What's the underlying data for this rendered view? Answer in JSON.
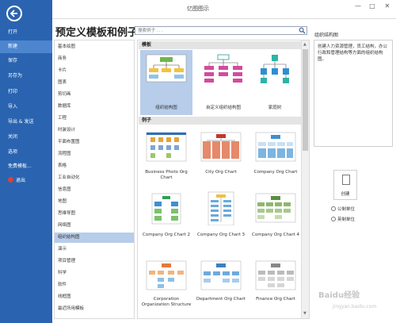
{
  "window": {
    "title": "亿图图示",
    "minimize": "—",
    "maximize": "□",
    "close": "✕"
  },
  "sidebar": {
    "back_icon": "arrow-left-icon",
    "items": [
      {
        "label": "打开"
      },
      {
        "label": "新建",
        "active": true
      },
      {
        "label": "保存"
      },
      {
        "label": "另存为"
      },
      {
        "label": "打印"
      },
      {
        "label": "导入"
      },
      {
        "label": "导出 & 发送"
      },
      {
        "label": "关闭"
      },
      {
        "label": "选项"
      },
      {
        "label": "免费模板..."
      },
      {
        "label": "退出"
      }
    ]
  },
  "main": {
    "heading": "预定义模板和例子",
    "search": {
      "placeholder": "搜索例子 . . .",
      "icon": "search-icon"
    }
  },
  "categories": [
    "基本绘图",
    "商务",
    "卡片",
    "图表",
    "剪切画",
    "数据库",
    "工程",
    "时装设计",
    "平面布置图",
    "流程图",
    "表格",
    "工业自动化",
    "信息图",
    "地图",
    "思维导图",
    "网络图",
    "组织结构图",
    "演示",
    "项目管理",
    "科学",
    "软件",
    "线框图",
    "最近所用模板"
  ],
  "selected_category": "组织结构图",
  "gallery": {
    "templates_header": "模板",
    "examples_header": "例子",
    "templates": [
      {
        "label": "组织结构图",
        "selected": true
      },
      {
        "label": "自定义组织结构图"
      },
      {
        "label": "家庭树"
      }
    ],
    "examples": [
      {
        "label": "Business Photo Org Chart"
      },
      {
        "label": "City Org Chart"
      },
      {
        "label": "Company Org Chart"
      },
      {
        "label": "Company Org Chart 2"
      },
      {
        "label": "Company Org Chart 3"
      },
      {
        "label": "Company Org Chart 4"
      },
      {
        "label": "Corporation Organization Structure"
      },
      {
        "label": "Department Org Chart"
      },
      {
        "label": "Finance Org Chart"
      }
    ]
  },
  "details": {
    "title": "组织结构图",
    "description": "创建人力资源管理，员工结构，办公行政和管理结构等方面的组织结构图。",
    "create_label": "创建",
    "units": [
      {
        "label": "公制单位",
        "checked": false
      },
      {
        "label": "英制单位",
        "checked": false
      }
    ]
  },
  "watermark": {
    "text": "Baidu经验",
    "sub": "jingyan.baidu.com"
  },
  "colors": {
    "sidebar": "#2a64b0",
    "sidebar_active": "#4d86cf",
    "selection": "#b7cdea",
    "exit": "#d9423c"
  }
}
